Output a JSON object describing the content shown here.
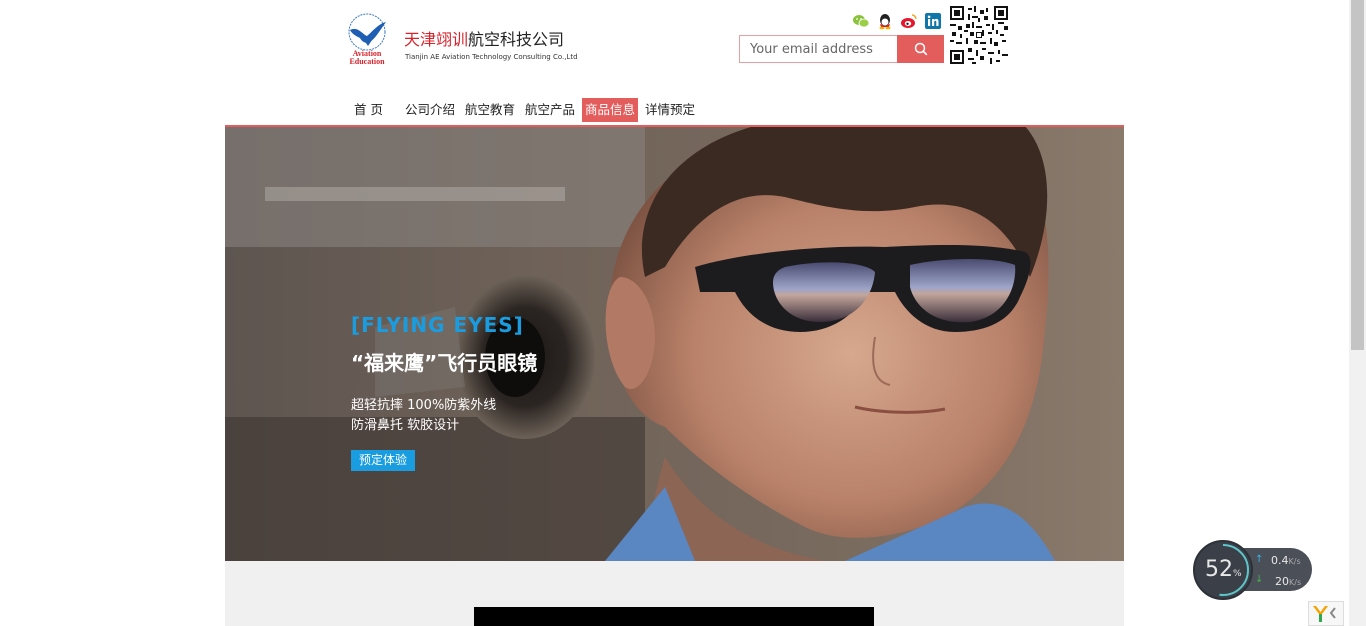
{
  "header": {
    "logo_cn_red": "天津翊训",
    "logo_cn_rest": "航空科技公司",
    "logo_en": "Tianjin AE Aviation Technology Consulting Co.,Ltd",
    "logo_emblem_line1": "Aviation",
    "logo_emblem_line2": "Education",
    "email_placeholder": "Your email address",
    "social_icons": [
      "wechat-icon",
      "qq-icon",
      "weibo-icon",
      "linkedin-icon"
    ]
  },
  "nav": {
    "items": [
      {
        "label": "首 页"
      },
      {
        "label": "公司介绍"
      },
      {
        "label": "航空教育"
      },
      {
        "label": "航空产品"
      },
      {
        "label": "商品信息"
      },
      {
        "label": "详情预定"
      }
    ],
    "active_index": 4
  },
  "hero": {
    "tag": "[FLYING EYES]",
    "title": "“福来鹰”飞行员眼镜",
    "line1": "超轻抗摔 100%防紫外线",
    "line2": "防滑鼻托 软胶设计",
    "button": "预定体验"
  },
  "net_widget": {
    "percent": "52",
    "percent_unit": "%",
    "up_value": "0.4",
    "down_value": "20",
    "rate_unit": "K/s"
  },
  "colors": {
    "accent": "#e35d5d",
    "blue": "#1a9de0",
    "logo_red": "#d6232c"
  }
}
